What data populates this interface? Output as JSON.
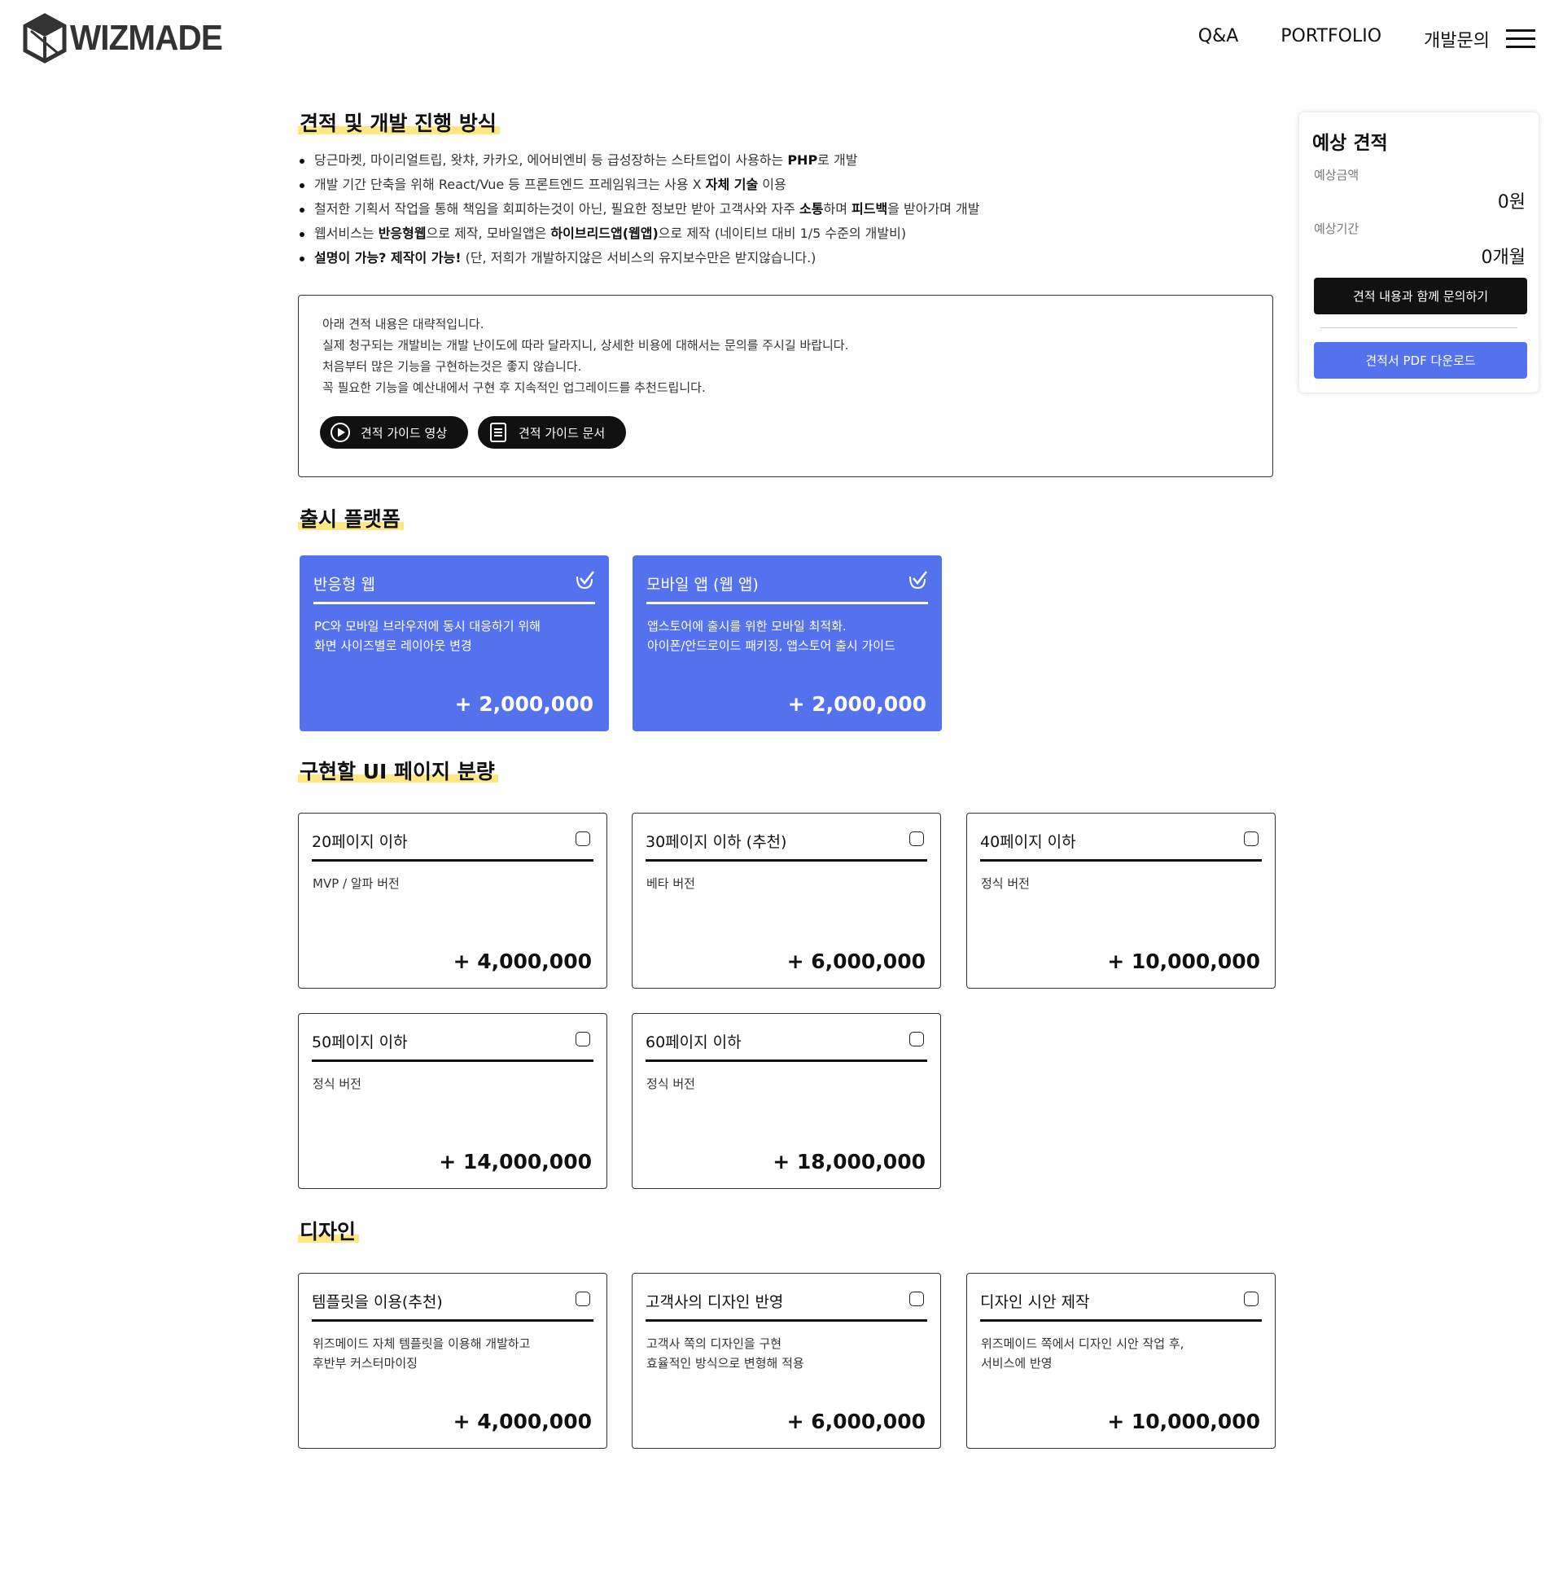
{
  "header": {
    "logo_text": "WIZMADE",
    "nav": [
      "Q&A",
      "PORTFOLIO",
      "개발문의"
    ]
  },
  "process": {
    "title": "견적 및 개발 진행 방식",
    "bullets": [
      [
        {
          "t": "당근마켓, 마이리얼트립, 왓챠, 카카오, 에어비엔비 등 급성장하는 스타트업이 사용하는 "
        },
        {
          "t": "PHP",
          "b": true
        },
        {
          "t": "로 개발"
        }
      ],
      [
        {
          "t": "개발 기간 단축을 위해 React/Vue 등 프론트엔드 프레임워크는 사용 X  "
        },
        {
          "t": "자체 기술",
          "b": true
        },
        {
          "t": " 이용"
        }
      ],
      [
        {
          "t": "철저한 기획서 작업을 통해 책임을 회피하는것이 아닌, 필요한 정보만 받아 고객사와 자주 "
        },
        {
          "t": "소통",
          "b": true
        },
        {
          "t": "하며 "
        },
        {
          "t": "피드백",
          "b": true
        },
        {
          "t": "을 받아가며 개발"
        }
      ],
      [
        {
          "t": "웹서비스는 "
        },
        {
          "t": "반응형웹",
          "b": true
        },
        {
          "t": "으로 제작,  모바일앱은 "
        },
        {
          "t": "하이브리드앱(웹앱)",
          "b": true
        },
        {
          "t": "으로 제작 (네이티브 대비 1/5 수준의 개발비)"
        }
      ],
      [
        {
          "t": "설명이 가능? 제작이 가능!",
          "b": true
        },
        {
          "t": " (단, 저희가 개발하지않은 서비스의 유지보수만은 받지않습니다.)"
        }
      ]
    ]
  },
  "notice": {
    "lines": [
      "아래 견적 내용은 대략적입니다.",
      "실제 청구되는 개발비는 개발 난이도에 따라 달라지니, 상세한 비용에 대해서는 문의를 주시길 바랍니다.",
      "처음부터 많은 기능을 구현하는것은 좋지 않습니다.",
      "꼭 필요한 기능을 예산내에서 구현 후 지속적인 업그레이드를 추천드립니다."
    ],
    "video_button": "견적 가이드 영상",
    "doc_button": "견적 가이드 문서"
  },
  "platform": {
    "title": "출시 플랫폼",
    "cards": [
      {
        "title": "반응형 웹",
        "desc": [
          "PC와 모바일 브라우저에 동시 대응하기 위해",
          "화면 사이즈별로 레이아웃 변경"
        ],
        "price": "+ 2,000,000",
        "selected": true
      },
      {
        "title": "모바일 앱 (웹 앱)",
        "desc": [
          "앱스토어에 출시를 위한 모바일 최적화.",
          "아이폰/안드로이드 패키징, 앱스토어 출시 가이드"
        ],
        "price": "+ 2,000,000",
        "selected": true
      }
    ]
  },
  "pages": {
    "title": "구현할 UI 페이지 분량",
    "cards": [
      {
        "title": "20페이지 이하",
        "desc": [
          "MVP / 알파 버전"
        ],
        "price": "+ 4,000,000",
        "selected": false
      },
      {
        "title": "30페이지 이하  (추천)",
        "desc": [
          "베타 버전"
        ],
        "price": "+ 6,000,000",
        "selected": false
      },
      {
        "title": "40페이지 이하",
        "desc": [
          "정식 버전"
        ],
        "price": "+ 10,000,000",
        "selected": false
      },
      {
        "title": "50페이지 이하",
        "desc": [
          "정식 버전"
        ],
        "price": "+ 14,000,000",
        "selected": false
      },
      {
        "title": "60페이지 이하",
        "desc": [
          "정식 버전"
        ],
        "price": "+ 18,000,000",
        "selected": false
      }
    ]
  },
  "design": {
    "title": "디자인",
    "cards": [
      {
        "title": "템플릿을 이용(추천)",
        "desc": [
          "위즈메이드 자체 템플릿을 이용해 개발하고",
          "후반부 커스터마이징"
        ],
        "price": "+ 4,000,000",
        "selected": false
      },
      {
        "title": "고객사의 디자인 반영",
        "desc": [
          "고객사 쪽의 디자인을 구현",
          "효율적인 방식으로 변형해 적용"
        ],
        "price": "+ 6,000,000",
        "selected": false
      },
      {
        "title": "디자인 시안 제작",
        "desc": [
          "위즈메이드 쪽에서 디자인 시안 작업 후,",
          "서비스에 반영"
        ],
        "price": "+ 10,000,000",
        "selected": false
      }
    ]
  },
  "estimate": {
    "title": "예상 견적",
    "amount_label": "예상금액",
    "amount_value": "0원",
    "period_label": "예상기간",
    "period_value": "0개월",
    "inquiry_button": "견적 내용과 함께 문의하기",
    "pdf_button": "견적서 PDF 다운로드"
  },
  "colors": {
    "accent": "#5572ee",
    "highlight": "#ffe784",
    "dark": "#111111"
  }
}
